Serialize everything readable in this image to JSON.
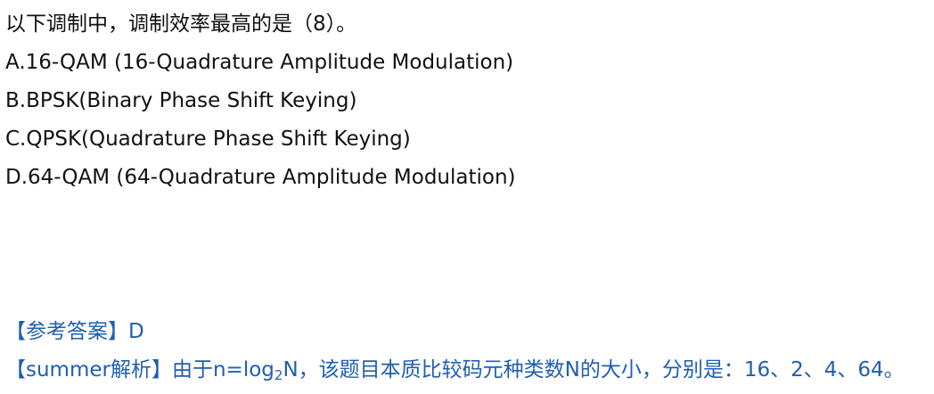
{
  "question": "以下调制中，调制效率最高的是（8）。",
  "options": [
    "A.16-QAM (16-Quadrature Amplitude Modulation)",
    "B.BPSK(Binary Phase Shift Keying)",
    "C.QPSK(Quadrature Phase Shift Keying)",
    "D.64-QAM (64-Quadrature Amplitude Modulation)"
  ],
  "answer": "【参考答案】D",
  "analysis": {
    "prefix": "【summer解析】由于n=log",
    "subscript": "2",
    "suffix": "N，该题目本质比较码元种类数N的大小，分别是：16、2、4、64。"
  },
  "colors": {
    "text": "#111111",
    "accent": "#1f5fb0"
  }
}
